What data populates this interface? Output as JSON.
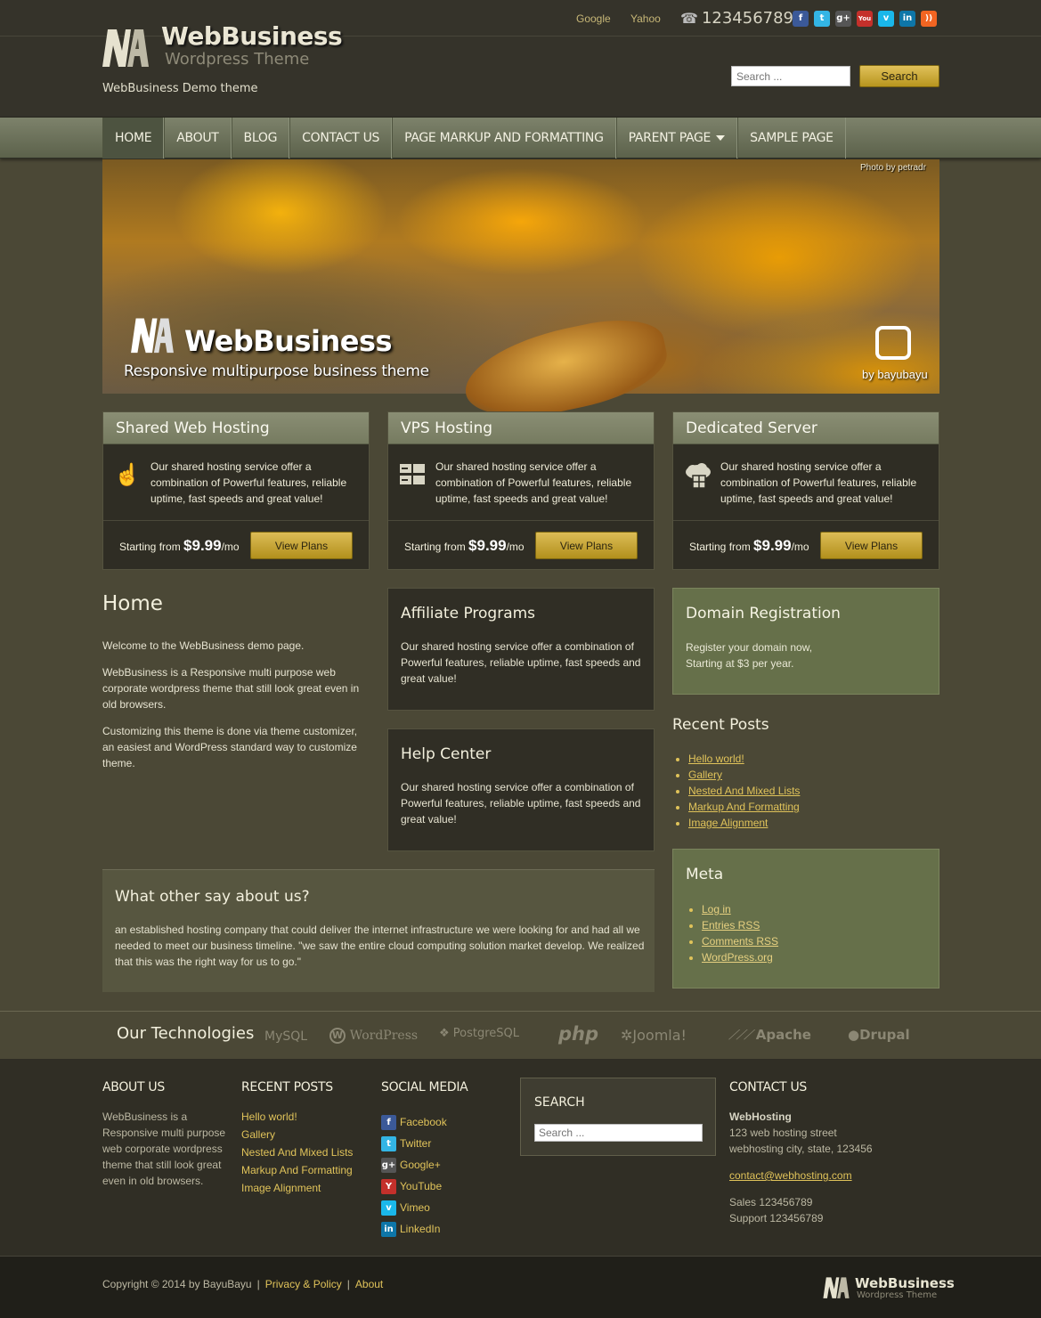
{
  "header": {
    "top_links": [
      "Google",
      "Yahoo"
    ],
    "phone": "123456789",
    "social": [
      {
        "icon": "facebook-icon",
        "glyph": "f",
        "color": "#3b5998"
      },
      {
        "icon": "twitter-icon",
        "glyph": "t",
        "color": "#33b5e5"
      },
      {
        "icon": "googleplus-icon",
        "glyph": "g+",
        "color": "#555555"
      },
      {
        "icon": "youtube-icon",
        "glyph": "You",
        "color": "#c4302b"
      },
      {
        "icon": "vimeo-icon",
        "glyph": "v",
        "color": "#1ab7ea"
      },
      {
        "icon": "linkedin-icon",
        "glyph": "in",
        "color": "#0e76a8"
      },
      {
        "icon": "rss-icon",
        "glyph": "))",
        "color": "#f26522"
      }
    ],
    "logo_title": "WebBusiness",
    "logo_subtitle": "Wordpress Theme",
    "tagline": "WebBusiness Demo theme",
    "search_placeholder": "Search ...",
    "search_button": "Search"
  },
  "nav": {
    "items": [
      "HOME",
      "ABOUT",
      "BLOG",
      "CONTACT US",
      "PAGE MARKUP AND FORMATTING",
      "PARENT PAGE",
      "SAMPLE PAGE"
    ],
    "active": "HOME"
  },
  "hero": {
    "credit": "Photo by petradr",
    "title": "WebBusiness",
    "subtitle": "Responsive multipurpose business theme",
    "badge_text": "by bayubayu"
  },
  "plans": [
    {
      "title": "Shared Web Hosting",
      "icon": "pointer-hand-icon",
      "text": "Our shared hosting service offer a combination of Powerful features, reliable uptime, fast speeds and great value!",
      "from": "Starting from",
      "price": "$9.99",
      "per": "/mo",
      "button": "View Plans"
    },
    {
      "title": "VPS Hosting",
      "icon": "server-icon",
      "text": "Our shared hosting service offer a combination of Powerful features, reliable uptime, fast speeds and great value!",
      "from": "Starting from",
      "price": "$9.99",
      "per": "/mo",
      "button": "View Plans"
    },
    {
      "title": "Dedicated Server",
      "icon": "cloud-server-icon",
      "text": "Our shared hosting service offer a combination of Powerful features, reliable uptime, fast speeds and great value!",
      "from": "Starting from",
      "price": "$9.99",
      "per": "/mo",
      "button": "View Plans"
    }
  ],
  "home": {
    "title": "Home",
    "paragraphs": [
      "Welcome to the WebBusiness demo page.",
      "WebBusiness is a Responsive multi purpose web corporate wordpress theme that still look great even in old browsers.",
      "Customizing this theme is done via theme customizer, an easiest and WordPress standard way to customize theme."
    ]
  },
  "affiliate": {
    "title": "Affiliate Programs",
    "text": "Our shared hosting service offer a combination of Powerful features, reliable uptime, fast speeds and great value!"
  },
  "help": {
    "title": "Help Center",
    "text": "Our shared hosting service offer a combination of Powerful features, reliable uptime, fast speeds and great value!"
  },
  "domain": {
    "title": "Domain Registration",
    "line1": "Register your domain now,",
    "line2": "Starting at $3 per year."
  },
  "recent_posts": {
    "title": "Recent Posts",
    "items": [
      "Hello world!",
      "Gallery",
      "Nested And Mixed Lists",
      "Markup And Formatting",
      "Image Alignment"
    ]
  },
  "meta": {
    "title": "Meta",
    "items": [
      "Log in",
      "Entries RSS",
      "Comments RSS",
      "WordPress.org"
    ]
  },
  "testimonial": {
    "title": "What other say about us?",
    "text": "an established hosting company that could deliver the internet infrastructure we were looking for and had all we needed to meet our business timeline. \"we saw the entire cloud computing solution market develop. We realized that this was the right way for us to go.\""
  },
  "technologies": {
    "title": "Our Technologies",
    "logos": [
      "MySQL",
      "WordPress",
      "PostgreSQL",
      "php",
      "Joomla!",
      "Apache",
      "Drupal"
    ]
  },
  "footer": {
    "about_title": "ABOUT US",
    "about_text": "WebBusiness is a Responsive multi purpose web corporate wordpress theme that still look great even in old browsers.",
    "recent_title": "RECENT POSTS",
    "recent_items": [
      "Hello world!",
      "Gallery",
      "Nested And Mixed Lists",
      "Markup And Formatting",
      "Image Alignment"
    ],
    "social_title": "SOCIAL MEDIA",
    "social_items": [
      {
        "label": "Facebook",
        "icon": "facebook-icon",
        "glyph": "f",
        "color": "#3b5998"
      },
      {
        "label": "Twitter",
        "icon": "twitter-icon",
        "glyph": "t",
        "color": "#33b5e5"
      },
      {
        "label": "Google+",
        "icon": "googleplus-icon",
        "glyph": "g+",
        "color": "#555555"
      },
      {
        "label": "YouTube",
        "icon": "youtube-icon",
        "glyph": "Y",
        "color": "#c4302b"
      },
      {
        "label": "Vimeo",
        "icon": "vimeo-icon",
        "glyph": "v",
        "color": "#1ab7ea"
      },
      {
        "label": "LinkedIn",
        "icon": "linkedin-icon",
        "glyph": "in",
        "color": "#0e76a8"
      }
    ],
    "search_title": "SEARCH",
    "search_placeholder": "Search ...",
    "contact_title": "CONTACT US",
    "contact_name": "WebHosting",
    "contact_addr1": "123 web hosting street",
    "contact_addr2": "webhosting city, state, 123456",
    "contact_email": "contact@webhosting.com",
    "contact_sales": "Sales 123456789",
    "contact_support": "Support 123456789"
  },
  "bottom": {
    "copyright": "Copyright © 2014 by BayuBayu",
    "links": [
      "Privacy & Policy",
      "About"
    ],
    "logo_title": "WebBusiness",
    "logo_subtitle": "Wordpress Theme"
  }
}
